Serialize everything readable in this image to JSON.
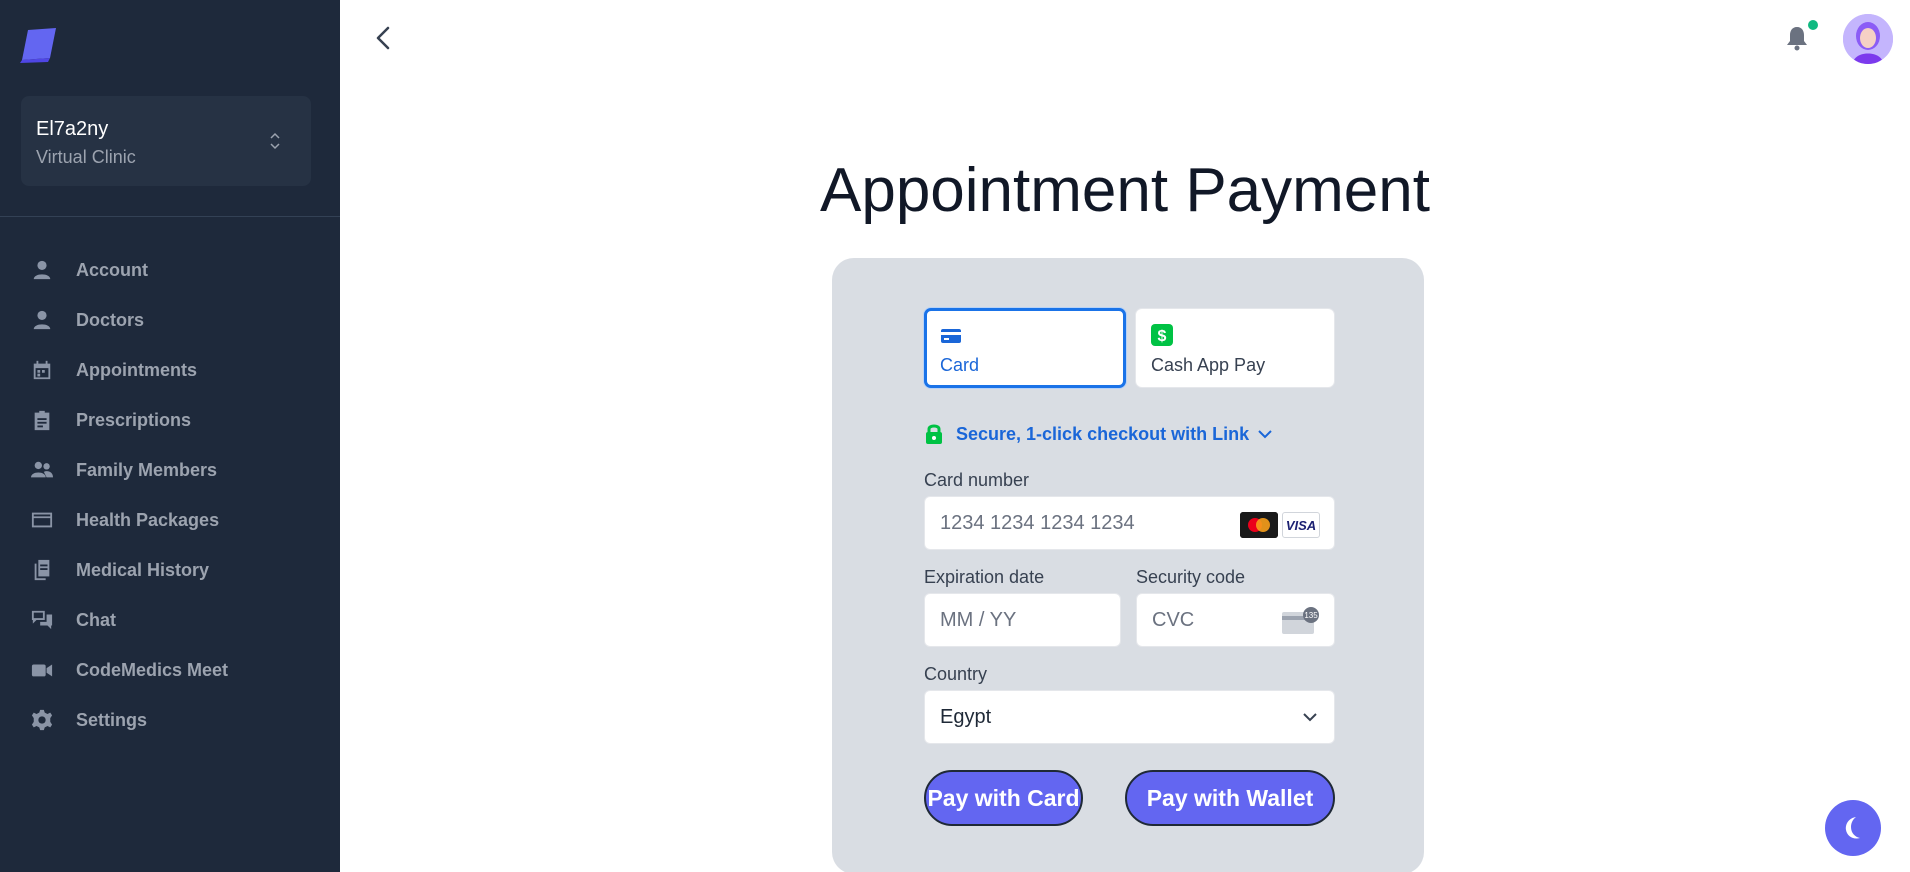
{
  "sidebar": {
    "clinic_name": "El7a2ny",
    "clinic_subtitle": "Virtual Clinic",
    "items": [
      {
        "label": "Account",
        "icon": "user-icon"
      },
      {
        "label": "Doctors",
        "icon": "user-icon"
      },
      {
        "label": "Appointments",
        "icon": "calendar-icon"
      },
      {
        "label": "Prescriptions",
        "icon": "clipboard-icon"
      },
      {
        "label": "Family Members",
        "icon": "users-icon"
      },
      {
        "label": "Health Packages",
        "icon": "credit-card-icon"
      },
      {
        "label": "Medical History",
        "icon": "documents-icon"
      },
      {
        "label": "Chat",
        "icon": "chat-icon"
      },
      {
        "label": "CodeMedics Meet",
        "icon": "video-icon"
      },
      {
        "label": "Settings",
        "icon": "gear-icon"
      }
    ]
  },
  "page": {
    "title": "Appointment Payment"
  },
  "payment": {
    "tabs": [
      {
        "label": "Card",
        "icon": "card-icon",
        "selected": true
      },
      {
        "label": "Cash App Pay",
        "icon": "cash-app-icon",
        "selected": false
      }
    ],
    "link_text": "Secure, 1-click checkout with Link",
    "card_number_label": "Card number",
    "card_number_placeholder": "1234 1234 1234 1234",
    "card_brand": "VISA",
    "expiration_label": "Expiration date",
    "expiration_placeholder": "MM / YY",
    "security_label": "Security code",
    "security_placeholder": "CVC",
    "cvc_badge": "135",
    "country_label": "Country",
    "country_value": "Egypt",
    "pay_card_label": "Pay with Card",
    "pay_wallet_label": "Pay with Wallet"
  },
  "colors": {
    "sidebar_bg": "#1e293b",
    "accent": "#6366f1",
    "link_blue": "#1a66d8",
    "panel_bg": "#d9dde3",
    "notification_dot": "#10b981"
  }
}
